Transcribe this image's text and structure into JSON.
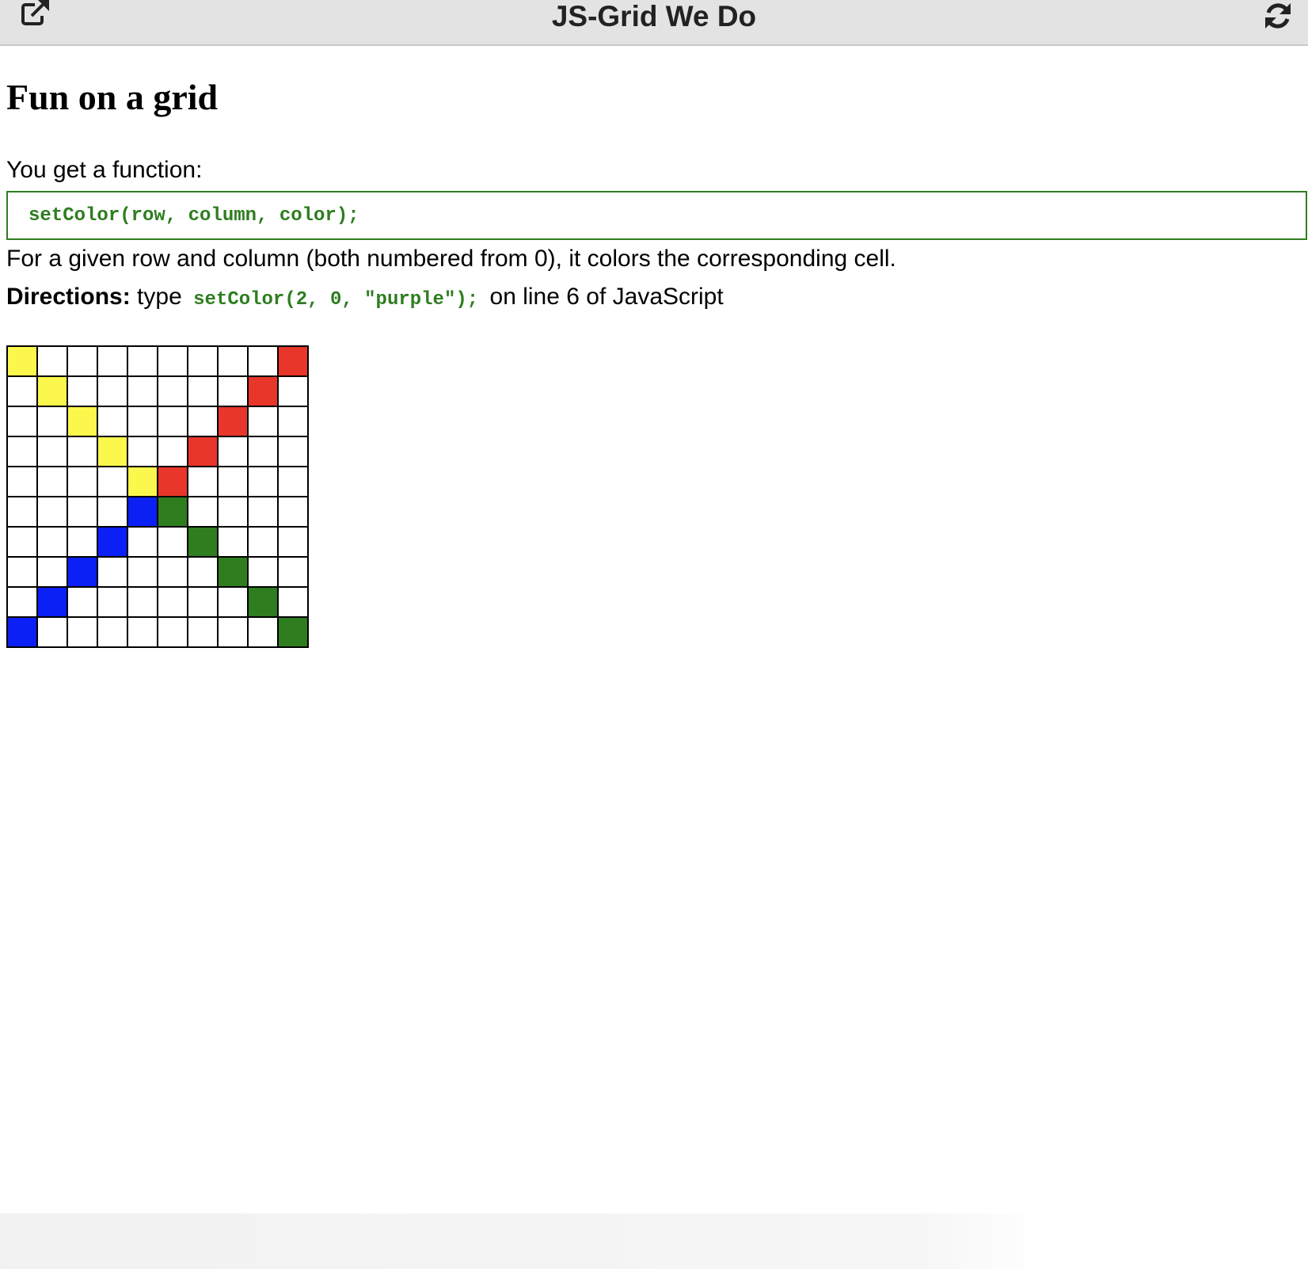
{
  "header": {
    "title": "JS-Grid We Do",
    "popout_icon": "external-link-icon",
    "refresh_icon": "refresh-icon"
  },
  "page": {
    "heading": "Fun on a grid",
    "intro": "You get a function:",
    "function_signature": "setColor(row, column, color);",
    "description": "For a given row and column (both numbered from 0), it colors the corresponding cell.",
    "directions_label": "Directions:",
    "directions_pre": "type",
    "directions_code": "setColor(2, 0, \"purple\");",
    "directions_post": "on line 6 of JavaScript"
  },
  "colors": {
    "code_green": "#2e7d1f",
    "yellow": "#fbf74c",
    "red": "#e8362a",
    "blue": "#0a20f5",
    "green": "#2e7d1f",
    "white": "#ffffff"
  },
  "grid": {
    "rows": 10,
    "columns": 10,
    "colored_cells": [
      {
        "row": 0,
        "column": 0,
        "color": "yellow"
      },
      {
        "row": 1,
        "column": 1,
        "color": "yellow"
      },
      {
        "row": 2,
        "column": 2,
        "color": "yellow"
      },
      {
        "row": 3,
        "column": 3,
        "color": "yellow"
      },
      {
        "row": 4,
        "column": 4,
        "color": "yellow"
      },
      {
        "row": 0,
        "column": 9,
        "color": "red"
      },
      {
        "row": 1,
        "column": 8,
        "color": "red"
      },
      {
        "row": 2,
        "column": 7,
        "color": "red"
      },
      {
        "row": 3,
        "column": 6,
        "color": "red"
      },
      {
        "row": 4,
        "column": 5,
        "color": "red"
      },
      {
        "row": 5,
        "column": 4,
        "color": "blue"
      },
      {
        "row": 6,
        "column": 3,
        "color": "blue"
      },
      {
        "row": 7,
        "column": 2,
        "color": "blue"
      },
      {
        "row": 8,
        "column": 1,
        "color": "blue"
      },
      {
        "row": 9,
        "column": 0,
        "color": "blue"
      },
      {
        "row": 5,
        "column": 5,
        "color": "green"
      },
      {
        "row": 6,
        "column": 6,
        "color": "green"
      },
      {
        "row": 7,
        "column": 7,
        "color": "green"
      },
      {
        "row": 8,
        "column": 8,
        "color": "green"
      },
      {
        "row": 9,
        "column": 9,
        "color": "green"
      }
    ]
  }
}
